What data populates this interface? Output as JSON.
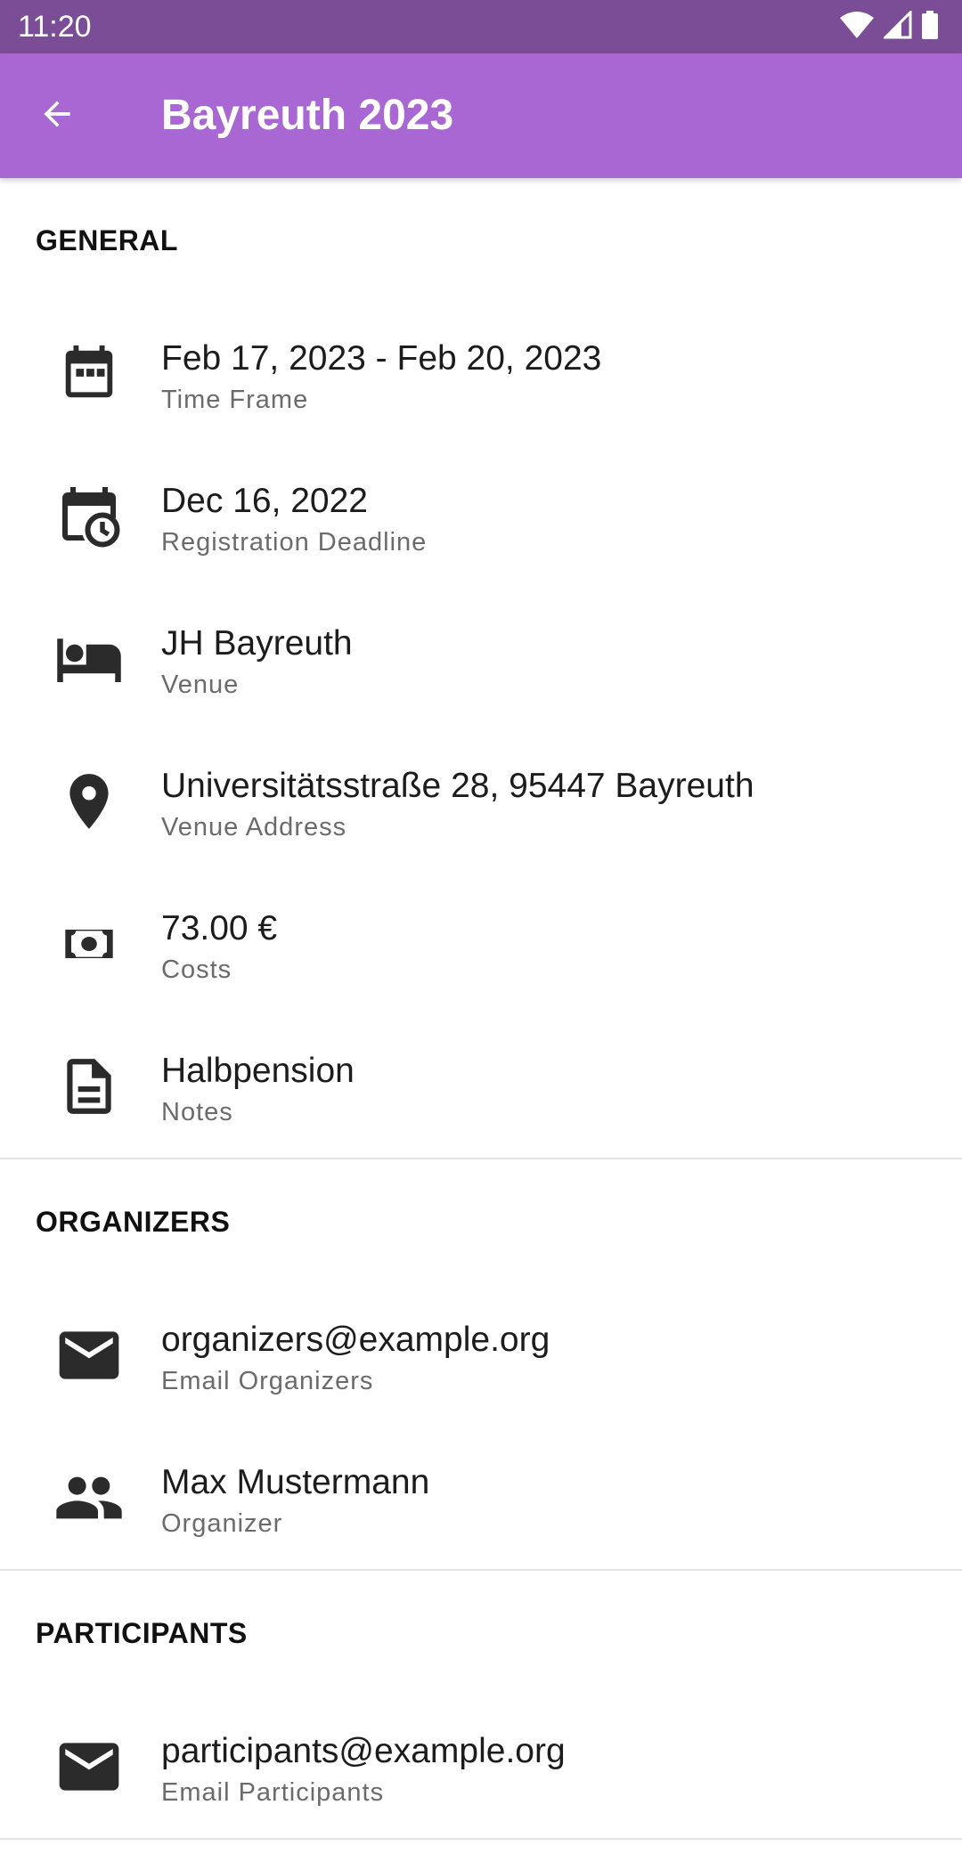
{
  "status_bar": {
    "time": "11:20",
    "icons": [
      "wifi-icon",
      "signal-icon",
      "battery-icon"
    ]
  },
  "app_bar": {
    "title": "Bayreuth 2023",
    "back_icon": "arrow-back-icon"
  },
  "colors": {
    "status_bar": "#7b4d97",
    "app_bar": "#a867d2",
    "icon": "#2b2b2b",
    "secondary_text": "#6b6b6b",
    "divider": "#e3e3e3"
  },
  "general": {
    "header": "GENERAL",
    "items": [
      {
        "icon": "calendar-icon",
        "primary": "Feb 17, 2023 - Feb 20, 2023",
        "secondary": "Time Frame"
      },
      {
        "icon": "calendar-clock-icon",
        "primary": "Dec 16, 2022",
        "secondary": "Registration Deadline"
      },
      {
        "icon": "bed-icon",
        "primary": "JH Bayreuth",
        "secondary": "Venue"
      },
      {
        "icon": "location-pin-icon",
        "primary": "Universitätsstraße 28, 95447 Bayreuth",
        "secondary": "Venue Address"
      },
      {
        "icon": "money-icon",
        "primary": "73.00 €",
        "secondary": "Costs"
      },
      {
        "icon": "document-icon",
        "primary": "Halbpension",
        "secondary": "Notes"
      }
    ]
  },
  "organizers": {
    "header": "ORGANIZERS",
    "items": [
      {
        "icon": "email-icon",
        "primary": "organizers@example.org",
        "secondary": "Email Organizers"
      },
      {
        "icon": "people-icon",
        "primary": "Max Mustermann",
        "secondary": "Organizer"
      }
    ]
  },
  "participants": {
    "header": "PARTICIPANTS",
    "items": [
      {
        "icon": "email-icon",
        "primary": "participants@example.org",
        "secondary": "Email Participants"
      }
    ]
  }
}
